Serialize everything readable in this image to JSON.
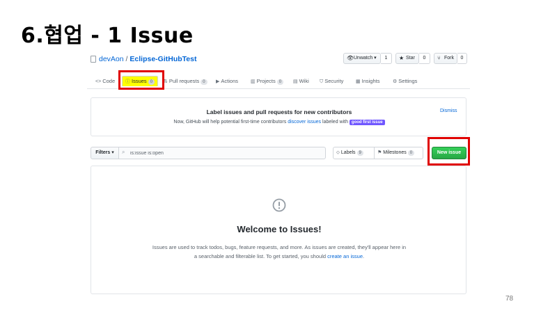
{
  "slide": {
    "title": "6.협업 - 1 Issue",
    "page_number": "78"
  },
  "repo": {
    "owner": "devAon",
    "separator": "/",
    "name": "Eclipse-GitHubTest",
    "watch_label": "Unwatch ▾",
    "watch_count": "1",
    "star_label": "Star",
    "star_count": "0",
    "fork_label": "Fork",
    "fork_count": "0"
  },
  "tabs": [
    {
      "label": "Code",
      "icon": "code-icon"
    },
    {
      "label": "Issues",
      "count": "0",
      "icon": "issue-icon",
      "selected": true
    },
    {
      "label": "Pull requests",
      "count": "0",
      "icon": "pull-request-icon"
    },
    {
      "label": "Actions",
      "icon": "play-icon"
    },
    {
      "label": "Projects",
      "count": "0",
      "icon": "project-icon"
    },
    {
      "label": "Wiki",
      "icon": "book-icon"
    },
    {
      "label": "Security",
      "icon": "shield-icon"
    },
    {
      "label": "Insights",
      "icon": "graph-icon"
    },
    {
      "label": "Settings",
      "icon": "gear-icon"
    }
  ],
  "banner": {
    "title": "Label issues and pull requests for new contributors",
    "text_before": "Now, GitHub will help potential first-time contributors ",
    "link": "discover issues",
    "text_after": " labeled with ",
    "badge": "good first issue",
    "dismiss": "Dismiss"
  },
  "filters": {
    "button": "Filters ▾",
    "query": "is:issue is:open",
    "labels_label": "Labels",
    "labels_count": "9",
    "milestones_label": "Milestones",
    "milestones_count": "0",
    "new_issue": "New issue"
  },
  "blankslate": {
    "title": "Welcome to Issues!",
    "line1": "Issues are used to track todos, bugs, feature requests, and more. As issues are created, they'll appear here in",
    "line2_before": "a searchable and filterable list. To get started, you should ",
    "line2_link": "create an issue",
    "line2_after": "."
  },
  "colors": {
    "link": "#0366d6",
    "highlight": "#ffff00",
    "annotation": "#e00000",
    "new_issue_green": "#28a745",
    "badge_purple": "#7057ff"
  }
}
